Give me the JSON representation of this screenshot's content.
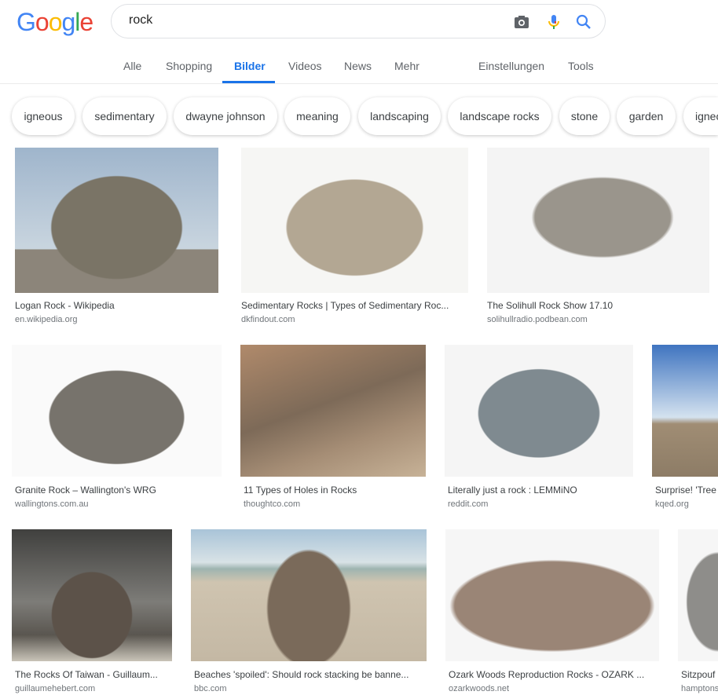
{
  "logo": "Google",
  "search": {
    "query": "rock"
  },
  "nav": {
    "tabs": [
      "Alle",
      "Shopping",
      "Bilder",
      "Videos",
      "News",
      "Mehr"
    ],
    "active": "Bilder",
    "settings": "Einstellungen",
    "tools": "Tools"
  },
  "chips": [
    "igneous",
    "sedimentary",
    "dwayne johnson",
    "meaning",
    "landscaping",
    "landscape rocks",
    "stone",
    "garden",
    "igneous"
  ],
  "results": [
    {
      "title": "Logan Rock - Wikipedia",
      "source": "en.wikipedia.org"
    },
    {
      "title": "Sedimentary Rocks | Types of Sedimentary Roc...",
      "source": "dkfindout.com"
    },
    {
      "title": "The Solihull Rock Show 17.10",
      "source": "solihullradio.podbean.com"
    },
    {
      "title": "Granite Rock – Wallington's WRG",
      "source": "wallingtons.com.au"
    },
    {
      "title": "11 Types of Holes in Rocks",
      "source": "thoughtco.com"
    },
    {
      "title": "Literally just a rock : LEMMiNO",
      "source": "reddit.com"
    },
    {
      "title": "Surprise! 'Tree",
      "source": "kqed.org"
    },
    {
      "title": "The Rocks Of Taiwan - Guillaum...",
      "source": "guillaumehebert.com"
    },
    {
      "title": "Beaches 'spoiled': Should rock stacking be banne...",
      "source": "bbc.com"
    },
    {
      "title": "Ozark Woods Reproduction Rocks - OZARK ...",
      "source": "ozarkwoods.net"
    },
    {
      "title": "Sitzpouf",
      "source": "hamptons"
    }
  ],
  "colors": {
    "accent": "#1a73e8",
    "google_blue": "#4285f4",
    "google_red": "#ea4335",
    "google_yellow": "#fbbc05",
    "google_green": "#34a853"
  }
}
